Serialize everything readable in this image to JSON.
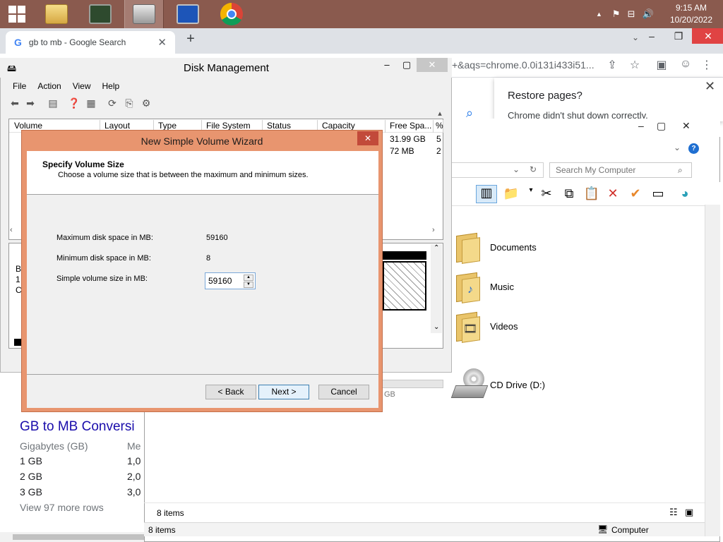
{
  "taskbar": {
    "apps": [
      "file-explorer",
      "system-monitor",
      "disk-tool",
      "control-panel",
      "chrome"
    ],
    "clock_time": "9:15 AM",
    "clock_date": "10/20/2022",
    "tray_chevron": "▲"
  },
  "chrome": {
    "tab_title": "gb to mb - Google Search",
    "tab_close": "✕",
    "new_tab": "+",
    "url_tail": "+&aqs=chrome.0.0i131i433i51...",
    "restore_title": "Restore pages?",
    "restore_body": "Chrome didn't shut down correctly.",
    "restore_close": "✕",
    "result_title": "GB to MB Conversi",
    "col1_header": "Gigabytes (GB)",
    "col2_header": "Me",
    "rows": [
      {
        "gb": "1 GB",
        "mb": "1,0"
      },
      {
        "gb": "2 GB",
        "mb": "2,0"
      },
      {
        "gb": "3 GB",
        "mb": "3,0"
      }
    ],
    "more_rows": "View 97 more rows"
  },
  "explorer": {
    "search_placeholder": "Search My Computer",
    "items": [
      "Documents",
      "Music",
      "Videos",
      "CD Drive (D:)"
    ],
    "status_items": "8 items",
    "status_items_bottom": "8 items",
    "status_location": "Computer"
  },
  "disk_mgmt": {
    "title": "Disk Management",
    "menu": [
      "File",
      "Action",
      "View",
      "Help"
    ],
    "columns": [
      "Volume",
      "Layout",
      "Type",
      "File System",
      "Status",
      "Capacity",
      "Free Spa...",
      "%"
    ],
    "free_space": [
      "31.99 GB",
      "72 MB"
    ],
    "percent": [
      "5",
      "2"
    ],
    "lower_labels": [
      "B",
      "1",
      "C"
    ],
    "gb_label": "GB"
  },
  "wizard": {
    "title": "New Simple Volume Wizard",
    "heading": "Specify Volume Size",
    "subheading": "Choose a volume size that is between the maximum and minimum sizes.",
    "max_label": "Maximum disk space in MB:",
    "max_value": "59160",
    "min_label": "Minimum disk space in MB:",
    "min_value": "8",
    "size_label": "Simple volume size in MB:",
    "size_value": "59160",
    "back_label": "< Back",
    "next_label": "Next >",
    "cancel_label": "Cancel"
  }
}
